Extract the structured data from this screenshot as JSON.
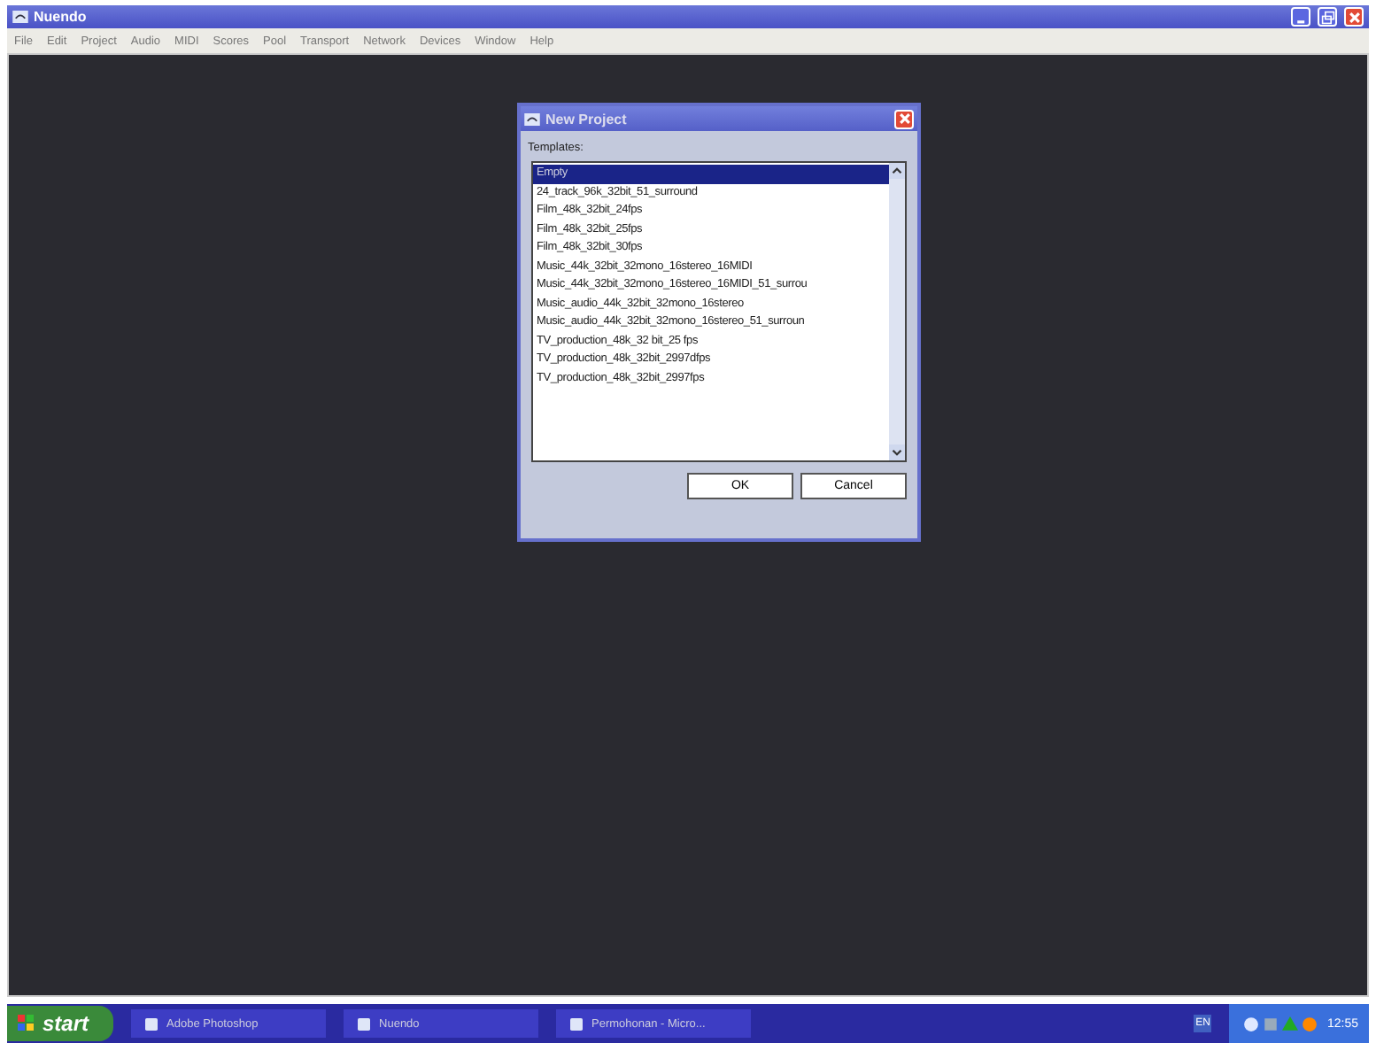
{
  "window": {
    "title": "Nuendo"
  },
  "menu": [
    "File",
    "Edit",
    "Project",
    "Audio",
    "MIDI",
    "Scores",
    "Pool",
    "Transport",
    "Network",
    "Devices",
    "Window",
    "Help"
  ],
  "dialog": {
    "title": "New Project",
    "label": "Templates:",
    "templates": [
      {
        "name": "Empty",
        "selected": true
      },
      {
        "name": "24_track_96k_32bit_51_surround",
        "selected": false
      },
      {
        "name": "Film_48k_32bit_24fps",
        "selected": false
      },
      {
        "name": "Film_48k_32bit_25fps",
        "selected": false
      },
      {
        "name": "Film_48k_32bit_30fps",
        "selected": false
      },
      {
        "name": "Music_44k_32bit_32mono_16stereo_16MIDI",
        "selected": false
      },
      {
        "name": "Music_44k_32bit_32mono_16stereo_16MIDI_51_surrou",
        "selected": false
      },
      {
        "name": "Music_audio_44k_32bit_32mono_16stereo",
        "selected": false
      },
      {
        "name": "Music_audio_44k_32bit_32mono_16stereo_51_surroun",
        "selected": false
      },
      {
        "name": "TV_production_48k_32 bit_25 fps",
        "selected": false
      },
      {
        "name": "TV_production_48k_32bit_2997dfps",
        "selected": false
      },
      {
        "name": "TV_production_48k_32bit_2997fps",
        "selected": false
      }
    ],
    "buttons": [
      "OK",
      "Cancel"
    ]
  },
  "taskbar": {
    "start": "start",
    "tasks": [
      "Adobe Photoshop",
      "Nuendo",
      "Permohonan - Micro..."
    ],
    "language": "EN",
    "clock": "12:55"
  }
}
